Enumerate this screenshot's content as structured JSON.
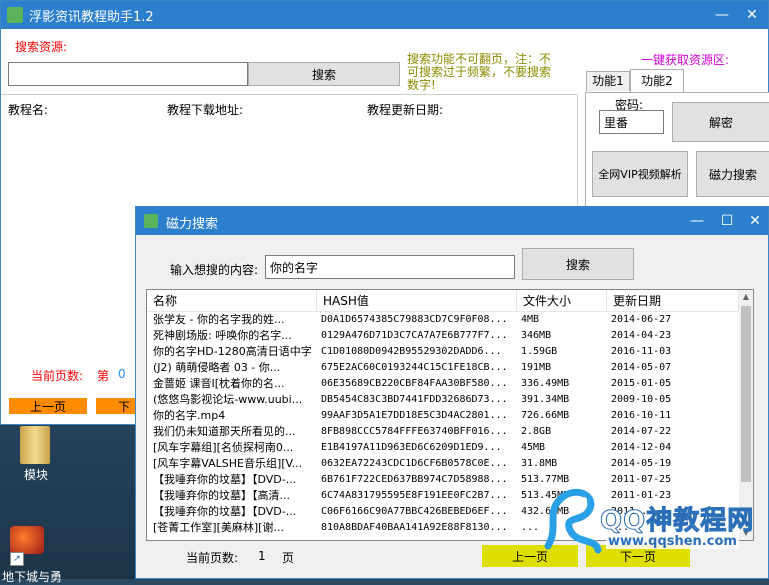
{
  "main": {
    "title": "浮影资讯教程助手1.2",
    "search_label": "搜索资源:",
    "search_value": "",
    "search_button": "搜索",
    "notice": "搜索功能不可翻页，注：不可搜索过于频繁，不要搜索数字!",
    "one_click_label": "一键获取资源区:",
    "tabs": [
      "功能1",
      "功能2"
    ],
    "password_label": "密码:",
    "password_value": "里番",
    "decrypt_button": "解密",
    "vip_button": "全网VIP视频解析",
    "magnet_button": "磁力搜索",
    "columns": [
      "教程名:",
      "教程下载地址:",
      "教程更新日期:"
    ],
    "page_label": "当前页数:",
    "page_prefix": "第",
    "page_number": "0",
    "prev_button": "上一页",
    "next_button": "下"
  },
  "desktop": {
    "icons": [
      {
        "label": "模块"
      },
      {
        "label": "地下城与勇"
      }
    ]
  },
  "dialog": {
    "title": "磁力搜索",
    "input_label": "输入想搜的内容:",
    "input_value": "你的名字",
    "search_button": "搜索",
    "columns": [
      "名称",
      "HASH值",
      "文件大小",
      "更新日期"
    ],
    "rows": [
      [
        "张学友 - 你的名字我的姓...",
        "D0A1D6574385C79883CD7C9F0F08...",
        "4MB",
        "2014-06-27"
      ],
      [
        "死神剧场版: 呼唤你的名字...",
        "0129A476D71D3C7CA7A7E6B777F7...",
        "346MB",
        "2014-04-23"
      ],
      [
        "你的名字HD-1280高清日语中字",
        "C1D01080D0942B95529302DADD6...",
        "1.59GB",
        "2016-11-03"
      ],
      [
        "(J2) 萌萌侵略者 03 - 你...",
        "675E2AC60C0193244C15C1FE18CB...",
        "191MB",
        "2014-05-07"
      ],
      [
        "金蔷姬 课音I[枕着你的名...",
        "06E35689CB220CBF84FAA30BF580...",
        "336.49MB",
        "2015-01-05"
      ],
      [
        "(悠悠鸟影视论坛-www.uubi...",
        "DB5454C83C3BD7441FDD32686D73...",
        "391.34MB",
        "2009-10-05"
      ],
      [
        "你的名字.mp4",
        "99AAF3D5A1E7DD18E5C3D4AC2801...",
        "726.66MB",
        "2016-10-11"
      ],
      [
        "我们仍未知道那天所看见的...",
        "8FB898CCC5784FFFE63740BFF016...",
        "2.8GB",
        "2014-07-22"
      ],
      [
        "[风车字幕组][名侦探柯南0...",
        "E1B4197A11D963ED6C6209D1ED9...",
        "45MB",
        "2014-12-04"
      ],
      [
        "[风车字幕VALSHE音乐组][V...",
        "0632EA72243CDC1D6CF6B0578C0E...",
        "31.8MB",
        "2014-05-19"
      ],
      [
        "【我唾弃你的坟墓】【DVD-...",
        "6B761F722CED637BB974C7D58988...",
        "513.77MB",
        "2011-07-25"
      ],
      [
        "【我唾弃你的坟墓】【高清...",
        "6C74A831795595E8F191EE0FC2B7...",
        "513.45MB",
        "2011-01-23"
      ],
      [
        "【我唾弃你的坟墓】【DVD-...",
        "C06F6166C90A77BBC426BEBED6EF...",
        "432.62MB",
        "2011-..."
      ],
      [
        "[苍菁工作室][美麻林][谢...",
        "810A8BDAF40BAA141A92E88F8130...",
        "...",
        "..."
      ]
    ],
    "page_label": "当前页数:",
    "page_number": "1",
    "page_unit": "页",
    "prev_button": "上一页",
    "next_button": "下一页"
  },
  "watermark": {
    "title": "QQ神教程网",
    "url": "www.qqshen.com"
  },
  "colors": {
    "title_bar": "#2b7fcc",
    "red_label": "#ff0000",
    "olive_notice": "#8b8b00",
    "magenta_label": "#d400d4",
    "orange_button": "#ff8c00",
    "yellow_button": "#dede00"
  }
}
